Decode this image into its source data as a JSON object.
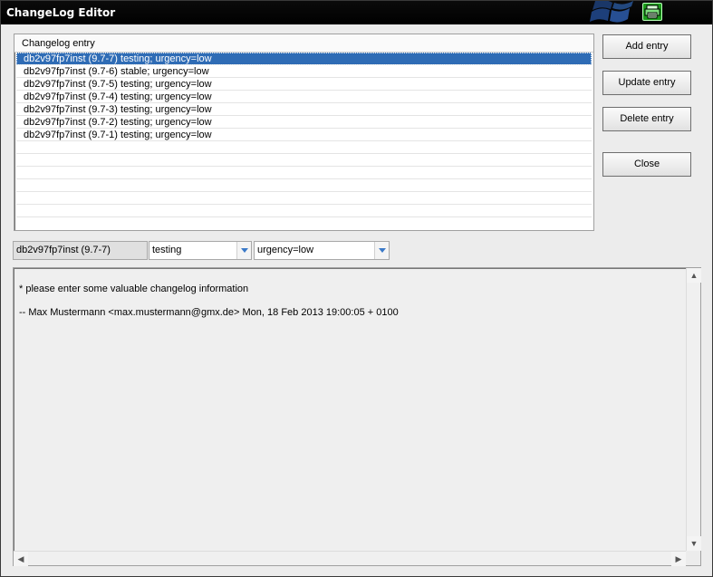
{
  "window": {
    "title": "ChangeLog Editor"
  },
  "list": {
    "header": "Changelog entry",
    "selected_index": 0,
    "items": [
      "db2v97fp7inst (9.7-7) testing; urgency=low",
      "db2v97fp7inst (9.7-6) stable; urgency=low",
      "db2v97fp7inst (9.7-5) testing; urgency=low",
      "db2v97fp7inst (9.7-4) testing; urgency=low",
      "db2v97fp7inst (9.7-3) testing; urgency=low",
      "db2v97fp7inst (9.7-2) testing; urgency=low",
      "db2v97fp7inst (9.7-1) testing; urgency=low"
    ]
  },
  "buttons": {
    "add": "Add entry",
    "update": "Update entry",
    "delete": "Delete entry",
    "close": "Close"
  },
  "fields": {
    "version": "db2v97fp7inst (9.7-7)",
    "distribution": "testing",
    "urgency": "urgency=low"
  },
  "editor": {
    "line1": "* please enter some valuable changelog information",
    "line2": "-- Max Mustermann <max.mustermann@gmx.de>  Mon, 18 Feb 2013 19:00:05 + 0100"
  }
}
